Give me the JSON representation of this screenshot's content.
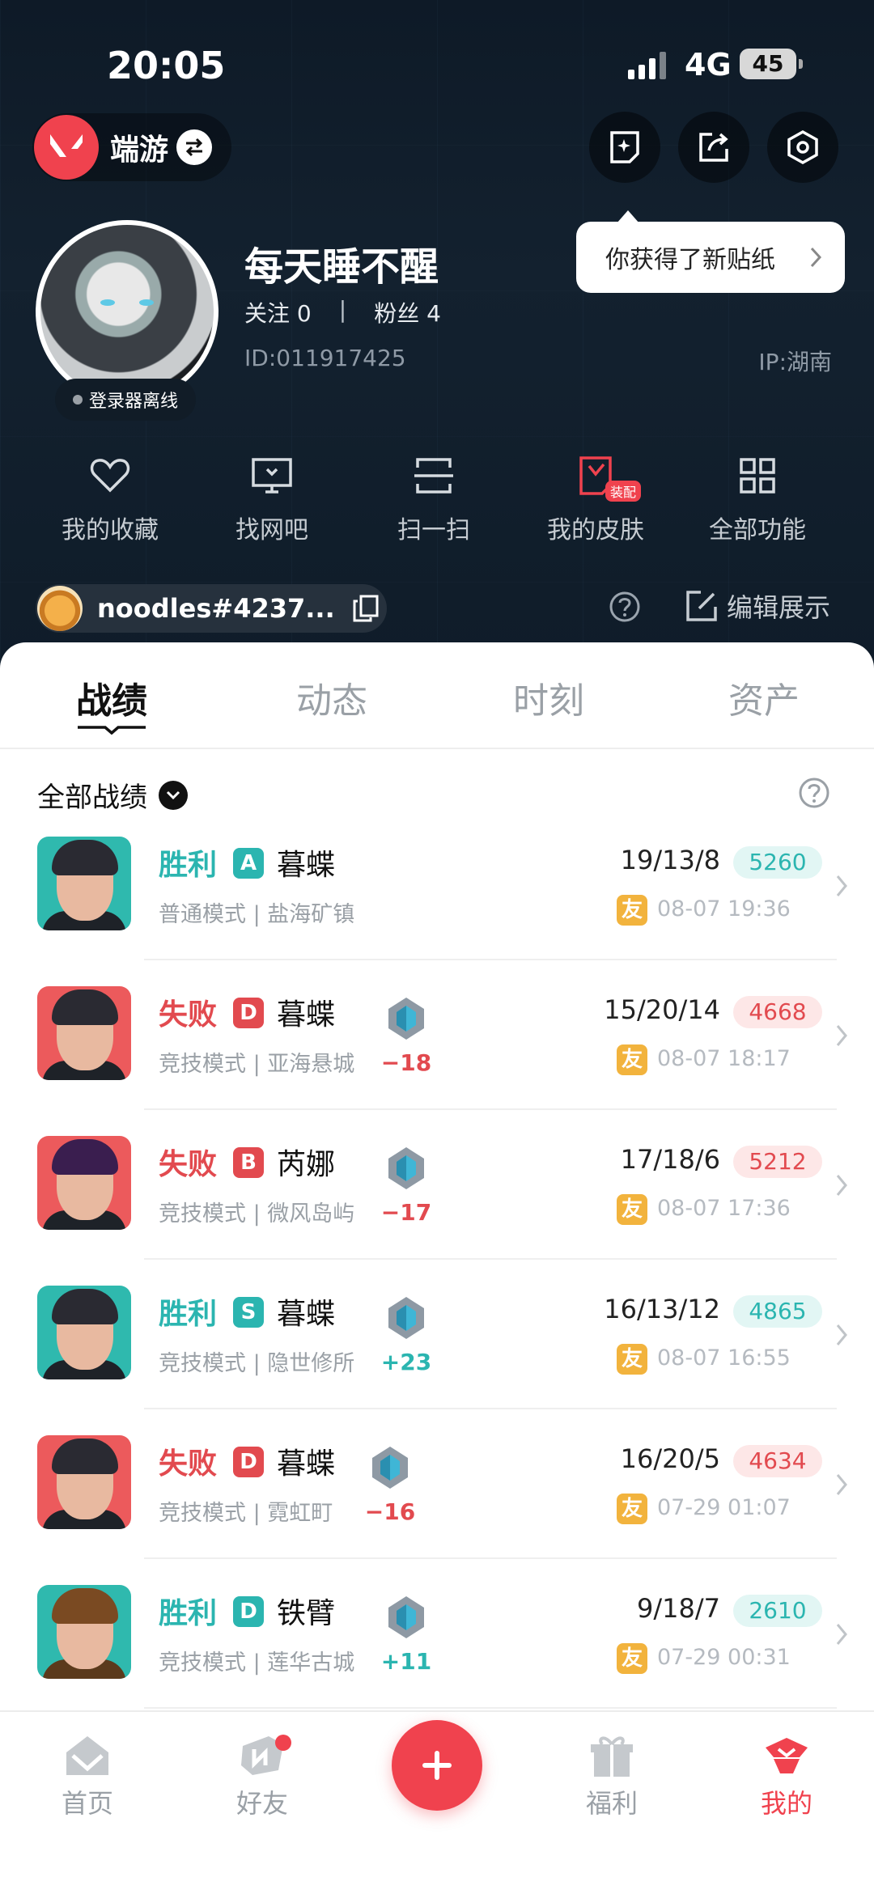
{
  "status": {
    "time": "20:05",
    "network": "4G",
    "battery": "45"
  },
  "header": {
    "switch_label": "端游",
    "tooltip": "你获得了新贴纸",
    "nickname": "每天睡不醒",
    "follow_label": "关注",
    "follow_count": "0",
    "fans_label": "粉丝",
    "fans_count": "4",
    "uid": "ID:011917425",
    "ip": "IP:湖南",
    "offline": "登录器离线"
  },
  "quick_actions": [
    {
      "label": "我的收藏",
      "icon": "heart-icon"
    },
    {
      "label": "找网吧",
      "icon": "monitor-icon"
    },
    {
      "label": "扫一扫",
      "icon": "scan-icon"
    },
    {
      "label": "我的皮肤",
      "icon": "skin-icon",
      "tag": "装配"
    },
    {
      "label": "全部功能",
      "icon": "grid-icon"
    }
  ],
  "riot_id": "noodles#4237...",
  "edit_label": "编辑展示",
  "tabs": [
    "战绩",
    "动态",
    "时刻",
    "资产"
  ],
  "filter_label": "全部战绩",
  "friend_tag": "友",
  "matches": [
    {
      "result": "胜利",
      "rank": "A",
      "agent": "暮蝶",
      "mode": "普通模式 | 盐海矿镇",
      "rr": "",
      "kda": "19/13/8",
      "score": "5260",
      "date": "08-07 19:36",
      "win": true
    },
    {
      "result": "失败",
      "rank": "D",
      "agent": "暮蝶",
      "mode": "竞技模式 | 亚海悬城",
      "rr": "−18",
      "kda": "15/20/14",
      "score": "4668",
      "date": "08-07 18:17",
      "win": false
    },
    {
      "result": "失败",
      "rank": "B",
      "agent": "芮娜",
      "mode": "竞技模式 | 微风岛屿",
      "rr": "−17",
      "kda": "17/18/6",
      "score": "5212",
      "date": "08-07 17:36",
      "win": false
    },
    {
      "result": "胜利",
      "rank": "S",
      "agent": "暮蝶",
      "mode": "竞技模式 | 隐世修所",
      "rr": "+23",
      "kda": "16/13/12",
      "score": "4865",
      "date": "08-07 16:55",
      "win": true
    },
    {
      "result": "失败",
      "rank": "D",
      "agent": "暮蝶",
      "mode": "竞技模式 | 霓虹町",
      "rr": "−16",
      "kda": "16/20/5",
      "score": "4634",
      "date": "07-29 01:07",
      "win": false
    },
    {
      "result": "胜利",
      "rank": "D",
      "agent": "铁臂",
      "mode": "竞技模式 | 莲华古城",
      "rr": "+11",
      "kda": "9/18/7",
      "score": "2610",
      "date": "07-29 00:31",
      "win": true
    }
  ],
  "bottom_nav": [
    {
      "label": "首页",
      "icon": "home-icon"
    },
    {
      "label": "好友",
      "icon": "friends-icon"
    },
    {
      "label": "福利",
      "icon": "gift-icon"
    },
    {
      "label": "我的",
      "icon": "profile-icon"
    }
  ],
  "colors": {
    "accent": "#f0424e",
    "win": "#2bb5b0",
    "loss": "#e24a4f",
    "friend_tag": "#f2b33d"
  }
}
